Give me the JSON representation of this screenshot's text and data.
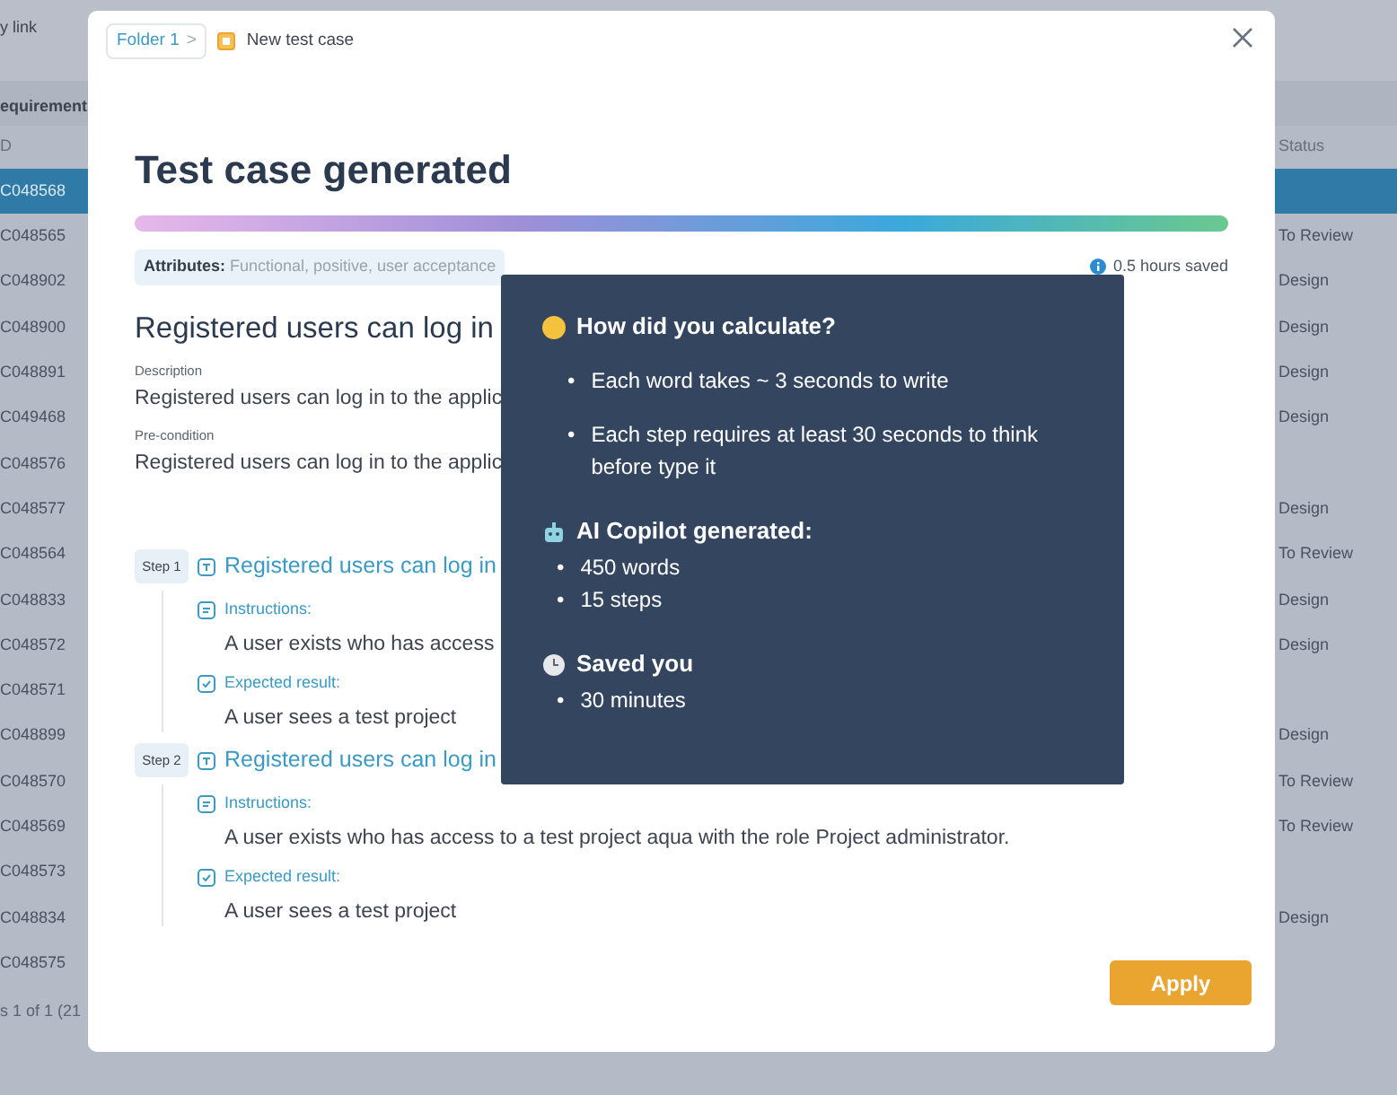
{
  "background": {
    "top_link": "y link",
    "column_header": "equirement",
    "id_header": "D",
    "status_header": "Status",
    "rows": [
      {
        "id": "C048568",
        "selected": true
      },
      {
        "id": "C048565",
        "status": "To Review",
        "selected": false
      },
      {
        "id": "C048902",
        "status": "Design",
        "selected": false
      },
      {
        "id": "C048900",
        "status": "Design",
        "selected": false
      },
      {
        "id": "C048891",
        "status": "Design",
        "selected": false
      },
      {
        "id": "C049468",
        "status": "Design",
        "selected": false
      },
      {
        "id": "C048576",
        "selected": false
      },
      {
        "id": "C048577",
        "status": "Design",
        "selected": false
      },
      {
        "id": "C048564",
        "status": "To Review",
        "selected": false
      },
      {
        "id": "C048833",
        "status": "Design",
        "selected": false
      },
      {
        "id": "C048572",
        "status": "Design",
        "selected": false
      },
      {
        "id": "C048571",
        "selected": false
      },
      {
        "id": "C048899",
        "status": "Design",
        "selected": false
      },
      {
        "id": "C048570",
        "status": "To Review",
        "selected": false
      },
      {
        "id": "C048569",
        "status": "To Review",
        "selected": false
      },
      {
        "id": "C048573",
        "selected": false
      },
      {
        "id": "C048834",
        "status": "Design",
        "selected": false
      },
      {
        "id": "C048575",
        "selected": false
      }
    ],
    "footer": "s 1 of 1 (21"
  },
  "modal": {
    "breadcrumb": {
      "folder": "Folder 1",
      "separator": ">",
      "current": "New test case"
    },
    "title": "Test case generated",
    "progress": {
      "level": 1
    },
    "attributes": {
      "label": "Attributes:",
      "value": "Functional, positive, user acceptance"
    },
    "saved": "0.5 hours saved",
    "heading": "Registered users can log in",
    "description_label": "Description",
    "description": "Registered users can log in to the applic",
    "precondition_label": "Pre-condition",
    "precondition": "Registered users can log in to the applic",
    "steps": [
      {
        "tag": "Step 1",
        "title": "Registered users can log in",
        "instructions_label": "Instructions:",
        "instructions": "A user exists who has access",
        "expected_label": "Expected result:",
        "expected": "A user sees a test project"
      },
      {
        "tag": "Step 2",
        "title": "Registered users can log in",
        "instructions_label": "Instructions:",
        "instructions": "A user exists who has access to a test project aqua with the role Project administrator.",
        "expected_label": "Expected result:",
        "expected": "A user sees a test project"
      }
    ],
    "apply": "Apply"
  },
  "popover": {
    "title": "How did you calculate?",
    "bullets": [
      {
        "bullet": "•",
        "text": "Each word takes ~ 3 seconds to write"
      },
      {
        "bullet": "•",
        "text": "Each step requires at least 30 seconds to think before type it"
      }
    ],
    "sections": [
      {
        "kind": "copilot",
        "title": "AI Copilot generated:",
        "items": [
          {
            "bullet": "•",
            "text": "450 words"
          },
          {
            "bullet": "•",
            "text": "15 steps"
          }
        ]
      },
      {
        "kind": "saved",
        "title": "Saved you",
        "items": [
          {
            "bullet": "•",
            "text": "30 minutes"
          }
        ]
      }
    ]
  }
}
